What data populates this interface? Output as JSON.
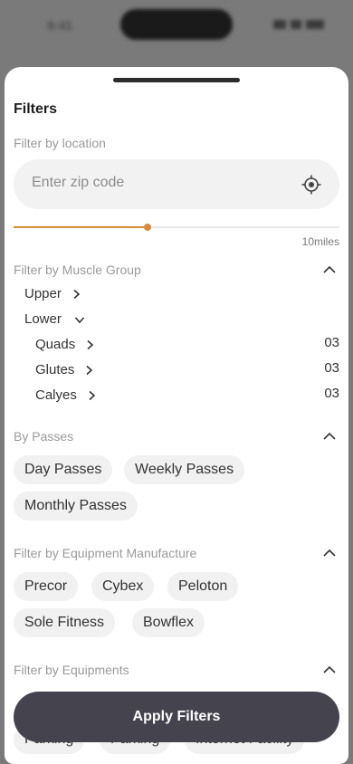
{
  "status_bar": {
    "time": "9:41"
  },
  "sheet": {
    "title": "Filters",
    "location": {
      "label": "Filter by location",
      "zip_placeholder": "Enter zip code",
      "zip_value": "",
      "distance_label": "10miles",
      "distance_fraction": 0.41
    },
    "muscle_group": {
      "label": "Filter by Muscle Group",
      "upper": "Upper",
      "lower": "Lower",
      "sub_items": [
        {
          "label": "Quads",
          "count": "03"
        },
        {
          "label": "Glutes",
          "count": "03"
        },
        {
          "label": "Calyes",
          "count": "03"
        }
      ]
    },
    "passes": {
      "label": "By Passes",
      "chips": [
        "Day Passes",
        "Weekly Passes",
        "Monthly Passes"
      ]
    },
    "manufacturer": {
      "label": "Filter by Equipment Manufacture",
      "chips": [
        "Precor",
        "Cybex",
        "Peloton",
        "Sole Fitness",
        "Bowflex"
      ]
    },
    "equipments": {
      "label": "Filter by Equipments",
      "chips": [
        "Parking",
        "Parking",
        "Internet Facility"
      ]
    },
    "apply_label": "Apply Filters"
  },
  "icons": {
    "collapse": "chevron-up-icon",
    "expand": "chevron-right-icon",
    "expanded": "chevron-down-icon",
    "location": "crosshair-location-icon"
  },
  "colors": {
    "accent": "#d98a35",
    "button": "#45434d",
    "chip": "#f1f1f1"
  }
}
